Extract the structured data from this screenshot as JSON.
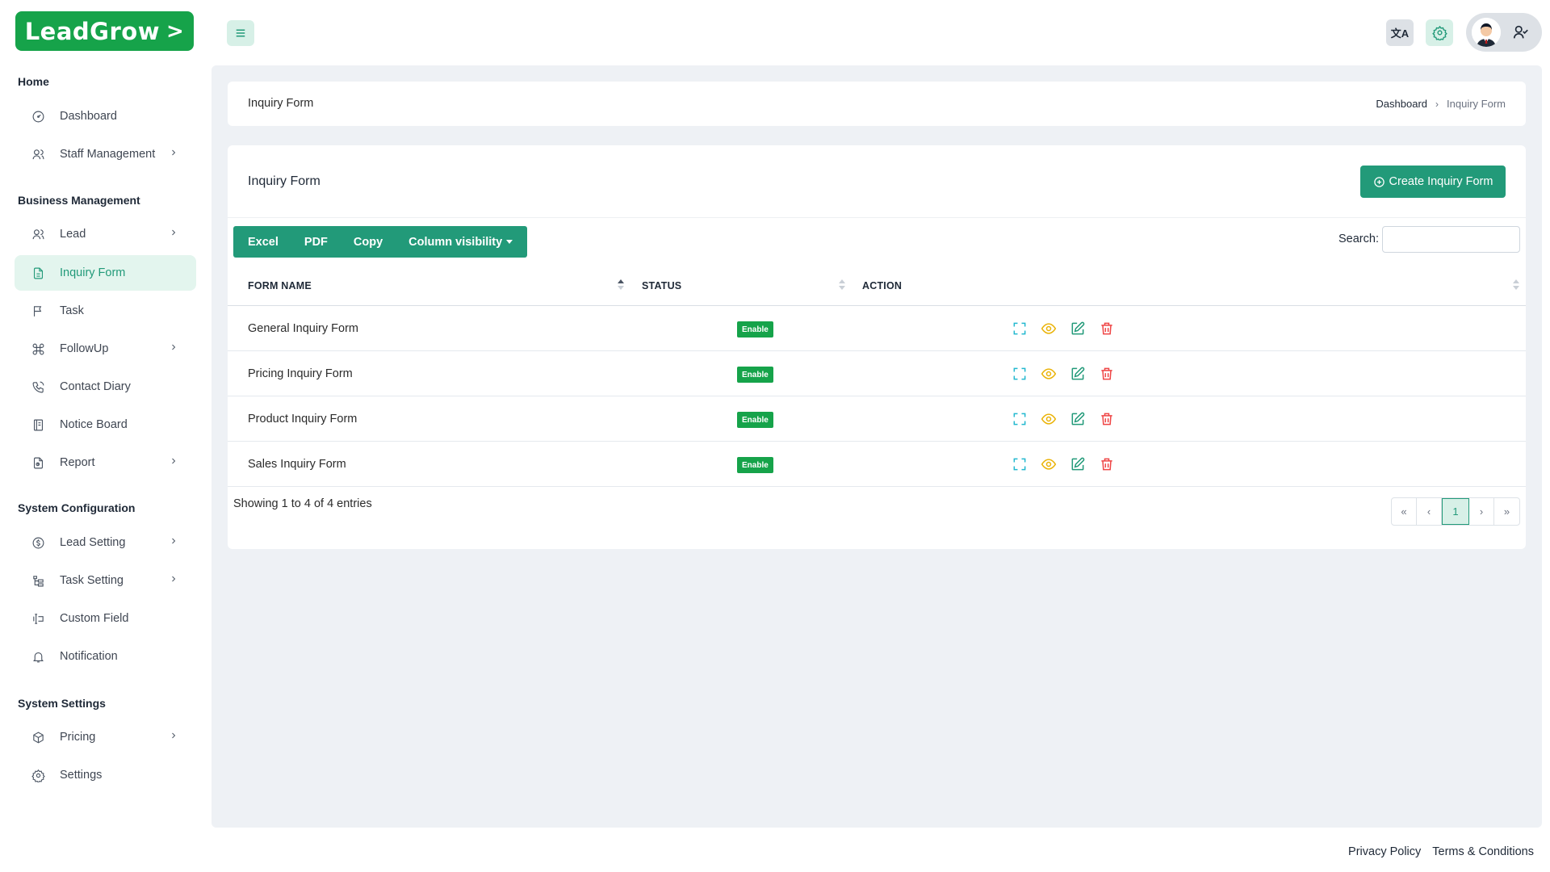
{
  "logo": {
    "text": "LeadGrow",
    "chevron": ">"
  },
  "sidebar": {
    "sections": [
      {
        "title": "Home"
      },
      {
        "title": "Business Management"
      },
      {
        "title": "System Configuration"
      },
      {
        "title": "System Settings"
      }
    ],
    "items": [
      {
        "label": "Dashboard",
        "icon": "dashboard-icon",
        "has_submenu": false
      },
      {
        "label": "Staff Management",
        "icon": "users-icon",
        "has_submenu": true
      },
      {
        "label": "Lead",
        "icon": "users-icon",
        "has_submenu": true
      },
      {
        "label": "Inquiry Form",
        "icon": "file-text-icon",
        "has_submenu": false,
        "active": true
      },
      {
        "label": "Task",
        "icon": "flag-icon",
        "has_submenu": false
      },
      {
        "label": "FollowUp",
        "icon": "command-icon",
        "has_submenu": true
      },
      {
        "label": "Contact Diary",
        "icon": "phone-icon",
        "has_submenu": false
      },
      {
        "label": "Notice Board",
        "icon": "notebook-icon",
        "has_submenu": false
      },
      {
        "label": "Report",
        "icon": "report-icon",
        "has_submenu": true
      },
      {
        "label": "Lead Setting",
        "icon": "coin-icon",
        "has_submenu": true
      },
      {
        "label": "Task Setting",
        "icon": "hierarchy-icon",
        "has_submenu": true
      },
      {
        "label": "Custom Field",
        "icon": "field-icon",
        "has_submenu": false
      },
      {
        "label": "Notification",
        "icon": "bell-icon",
        "has_submenu": false
      },
      {
        "label": "Pricing",
        "icon": "box-icon",
        "has_submenu": true
      },
      {
        "label": "Settings",
        "icon": "gear-icon",
        "has_submenu": false
      }
    ]
  },
  "topbar": {
    "translate_icon": "translate-icon",
    "settings_icon": "gear-icon",
    "user_icon": "user-check-icon"
  },
  "page": {
    "title": "Inquiry Form",
    "breadcrumb": {
      "home": "Dashboard",
      "current": "Inquiry Form"
    }
  },
  "card": {
    "title": "Inquiry Form",
    "create_button": "Create Inquiry Form",
    "export_buttons": {
      "excel": "Excel",
      "pdf": "PDF",
      "copy": "Copy",
      "column_visibility": "Column visibility"
    },
    "search_label": "Search:",
    "search_value": ""
  },
  "table": {
    "columns": [
      "FORM NAME",
      "STATUS",
      "ACTION"
    ],
    "rows": [
      {
        "name": "General Inquiry Form",
        "status": "Enable"
      },
      {
        "name": "Pricing Inquiry Form",
        "status": "Enable"
      },
      {
        "name": "Product Inquiry Form",
        "status": "Enable"
      },
      {
        "name": "Sales Inquiry Form",
        "status": "Enable"
      }
    ],
    "summary": "Showing 1 to 4 of 4 entries",
    "pagination": {
      "first": "«",
      "prev": "‹",
      "current": "1",
      "next": "›",
      "last": "»"
    }
  },
  "footer": {
    "privacy": "Privacy Policy",
    "terms": "Terms & Conditions"
  },
  "colors": {
    "brand": "#16a34a",
    "accent": "#229a79",
    "status_enable": "#16a34a",
    "delete": "#ef4444",
    "view": "#eab308",
    "expand": "#22b8cf"
  }
}
